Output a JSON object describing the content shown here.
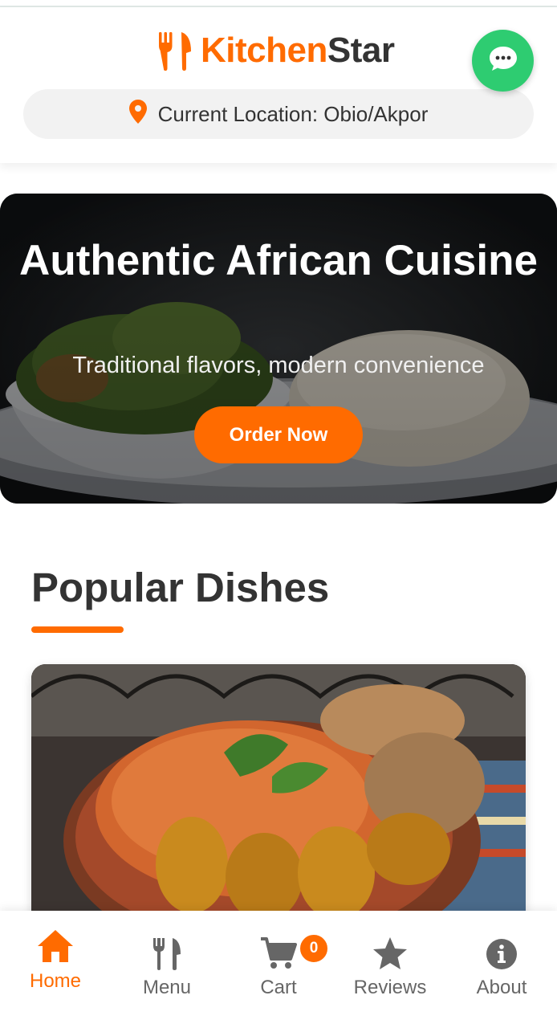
{
  "brand": {
    "name_part1": "Kitchen",
    "name_part2": "Star",
    "primary_color": "#ff6b00",
    "dark_color": "#333333"
  },
  "location": {
    "icon": "map-pin-icon",
    "text": "Current Location: Obio/Akpor"
  },
  "chat": {
    "icon": "chat-bubble-icon",
    "color": "#2ecc71"
  },
  "hero": {
    "title": "Authentic African Cuisine",
    "subtitle": "Traditional flavors, modern convenience",
    "cta_label": "Order Now"
  },
  "popular": {
    "title": "Popular Dishes"
  },
  "nav": {
    "items": [
      {
        "label": "Home",
        "icon": "home-icon",
        "active": true
      },
      {
        "label": "Menu",
        "icon": "fork-knife-icon",
        "active": false
      },
      {
        "label": "Cart",
        "icon": "cart-icon",
        "active": false
      },
      {
        "label": "Reviews",
        "icon": "star-icon",
        "active": false
      },
      {
        "label": "About",
        "icon": "info-icon",
        "active": false
      }
    ],
    "cart_count": "0"
  }
}
